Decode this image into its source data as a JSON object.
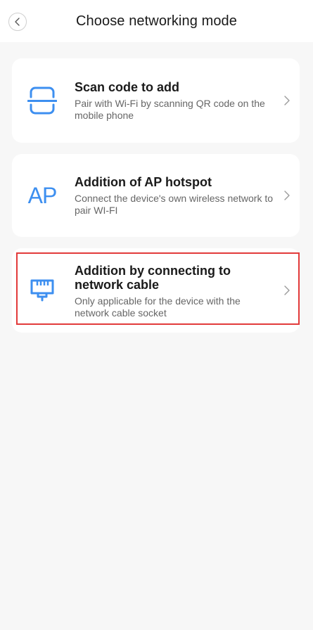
{
  "header": {
    "title": "Choose networking mode"
  },
  "options": [
    {
      "icon": "qr-scan-icon",
      "title": "Scan code to add",
      "description": "Pair with Wi-Fi by scanning QR code on the mobile phone"
    },
    {
      "icon": "ap-hotspot-icon",
      "icon_text": "AP",
      "title": "Addition of AP hotspot",
      "description": "Connect the device's own wireless network to pair WI-FI"
    },
    {
      "icon": "ethernet-port-icon",
      "title": "Addition by connecting to network cable",
      "description": "Only applicable for the device with the network cable socket",
      "highlighted": true
    }
  ],
  "colors": {
    "accent": "#3d8ff0",
    "highlight": "#e23a3a",
    "background": "#f7f7f7",
    "card": "#ffffff"
  }
}
